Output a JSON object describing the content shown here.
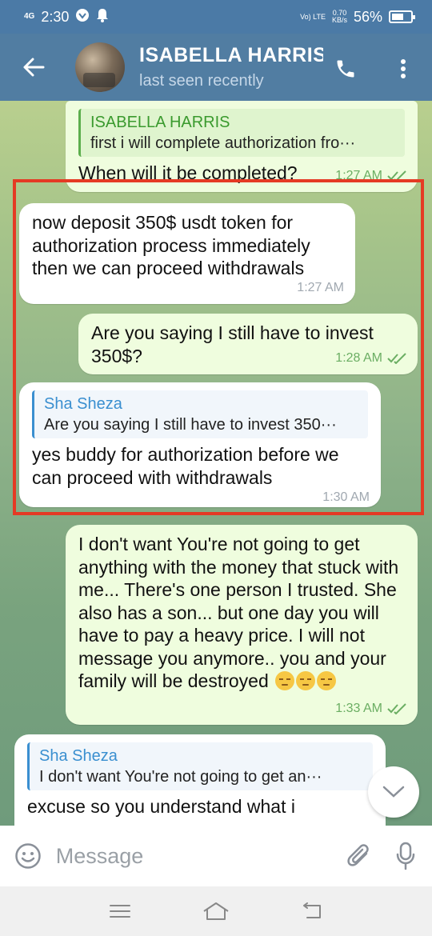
{
  "status_bar": {
    "network": "4G",
    "time": "2:30",
    "net_type": "Vo) LTE",
    "speed_value": "0.70",
    "speed_unit": "KB/s",
    "battery": "56%"
  },
  "header": {
    "title": "ISABELLA HARRIS",
    "subtitle": "last seen recently"
  },
  "messages": [
    {
      "reply_name": "ISABELLA HARRIS",
      "reply_text": "first i will complete authorization fro···",
      "text": "When will it be completed?",
      "time": "1:27 AM"
    },
    {
      "text": "now deposit 350$ usdt token for authorization process immediately then we can proceed withdrawals",
      "time": "1:27 AM"
    },
    {
      "text": "Are you saying I still have to invest 350$?",
      "time": "1:28 AM"
    },
    {
      "reply_name": "Sha Sheza",
      "reply_text": "Are you saying I still have to invest 350···",
      "text": "yes buddy for authorization before we can proceed with withdrawals",
      "time": "1:30 AM"
    },
    {
      "text": "I don't want  You're not going to get anything with the money that stuck with me... There's one person I trusted.  She also has a son... but one day you will have to pay a heavy price.  I will not message you anymore.. you and your family will be destroyed",
      "time": "1:33 AM"
    },
    {
      "reply_name": "Sha Sheza",
      "reply_text": "I don't want  You're not going to get an···",
      "text": "excuse so you understand what i"
    }
  ],
  "input": {
    "placeholder": "Message"
  },
  "colors": {
    "header": "#517da2",
    "outgoing_bubble": "#effdde",
    "incoming_bubble": "#ffffff",
    "highlight_box": "#e53a24"
  }
}
